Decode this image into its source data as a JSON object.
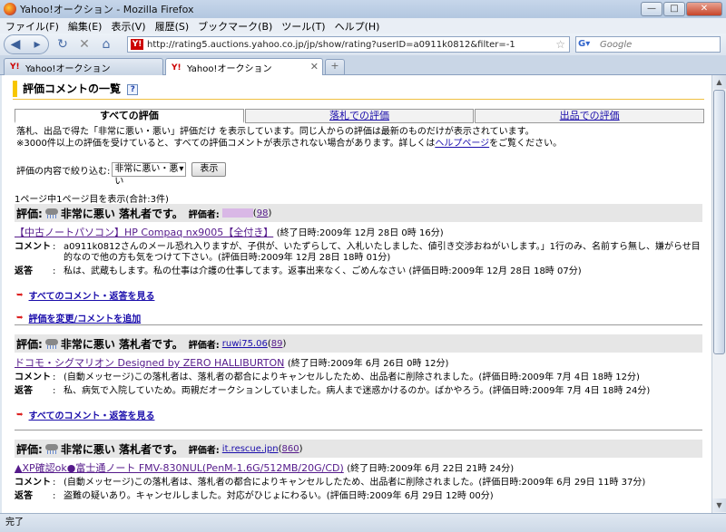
{
  "window": {
    "title": "Yahoo!オークション - Mozilla Firefox",
    "buttons": {
      "min": "—",
      "max": "□",
      "close": "✕"
    }
  },
  "menu": [
    "ファイル(F)",
    "編集(E)",
    "表示(V)",
    "履歴(S)",
    "ブックマーク(B)",
    "ツール(T)",
    "ヘルプ(H)"
  ],
  "nav": {
    "url": "http://rating5.auctions.yahoo.co.jp/jp/show/rating?userID=a0911k0812&filter=-1",
    "search_placeholder": "Google",
    "fav": "Y!"
  },
  "tabs": [
    {
      "label": "Yahoo!オークション",
      "active": false
    },
    {
      "label": "Yahoo!オークション",
      "active": true
    }
  ],
  "page": {
    "heading": "評価コメントの一覧",
    "help": "?",
    "filter_tabs": [
      "すべての評価",
      "落札での評価",
      "出品での評価"
    ],
    "note_line1": "落札、出品で得た「非常に悪い・悪い」評価だけ を表示しています。同じ人からの評価は最新のものだけが表示されています。",
    "note_line2_pre": "※3000件以上の評価を受けていると、すべての評価コメントが表示されない場合があります。詳しくは",
    "note_link": "ヘルプページ",
    "note_line2_post": "をご覧ください。",
    "filter_label": "評価の内容で絞り込む:",
    "filter_value": "非常に悪い・悪い",
    "filter_button": "表示",
    "page_info": "1ページ中1ページ目を表示(合計:3件)"
  },
  "labels": {
    "rating": "評価:",
    "bidder": "評価者:",
    "comment": "コメント",
    "reply": "返答",
    "colon": ":",
    "all_comments": "すべてのコメント・返答を見る",
    "change_rating": "評価を変更/コメントを追加"
  },
  "entries": [
    {
      "rating_text": "非常に悪い 落札者です。",
      "bidder": "",
      "bidder_count": "98",
      "item": "【中古ノートパソコン】HP Compaq nx9005【全付き】",
      "end_time": "(終了日時:2009年 12月 28日 0時 16分)",
      "comment": "a0911k0812さんのメール恐れ入りますが、子供が、いたずらして、入札いたしました、値引き交渉おねがいします。」1行のみ、名前すら無し、嫌がらせ目的なので他の方も気をつけて下さい。(評価日時:2009年 12月 28日 18時 01分)",
      "reply": "私は、武蔵もします。私の仕事は介護の仕事してます。返事出来なく、ごめんなさい (評価日時:2009年 12月 28日 18時 07分)"
    },
    {
      "rating_text": "非常に悪い 落札者です。",
      "bidder": "ruwi75.06",
      "bidder_count": "89",
      "item": "ドコモ・シグマリオン Designed by ZERO HALLIBURTON",
      "end_time": "(終了日時:2009年 6月 26日 0時 12分)",
      "comment": "(自動メッセージ)この落札者は、落札者の都合によりキャンセルしたため、出品者に削除されました。(評価日時:2009年 7月 4日 18時 12分)",
      "reply": "私、病気で入院していため。両親だオークションしていました。病人まで迷惑かけるのか。ばかやろう。(評価日時:2009年 7月 4日 18時 24分)"
    },
    {
      "rating_text": "非常に悪い 落札者です。",
      "bidder": "it.rescue.jpn",
      "bidder_count": "860",
      "item": "▲XP確認ok●富士通ノート FMV-830NUL(PenM-1.6G/512MB/20G/CD)",
      "end_time": "(終了日時:2009年 6月 22日 21時 24分)",
      "comment": "(自動メッセージ)この落札者は、落札者の都合によりキャンセルしたため、出品者に削除されました。(評価日時:2009年 6月 29日 11時 37分)",
      "reply": "盗難の疑いあり。キャンセルしました。対応がひじょにわるい。(評価日時:2009年 6月 29日 12時 00分)"
    }
  ],
  "status": "完了"
}
